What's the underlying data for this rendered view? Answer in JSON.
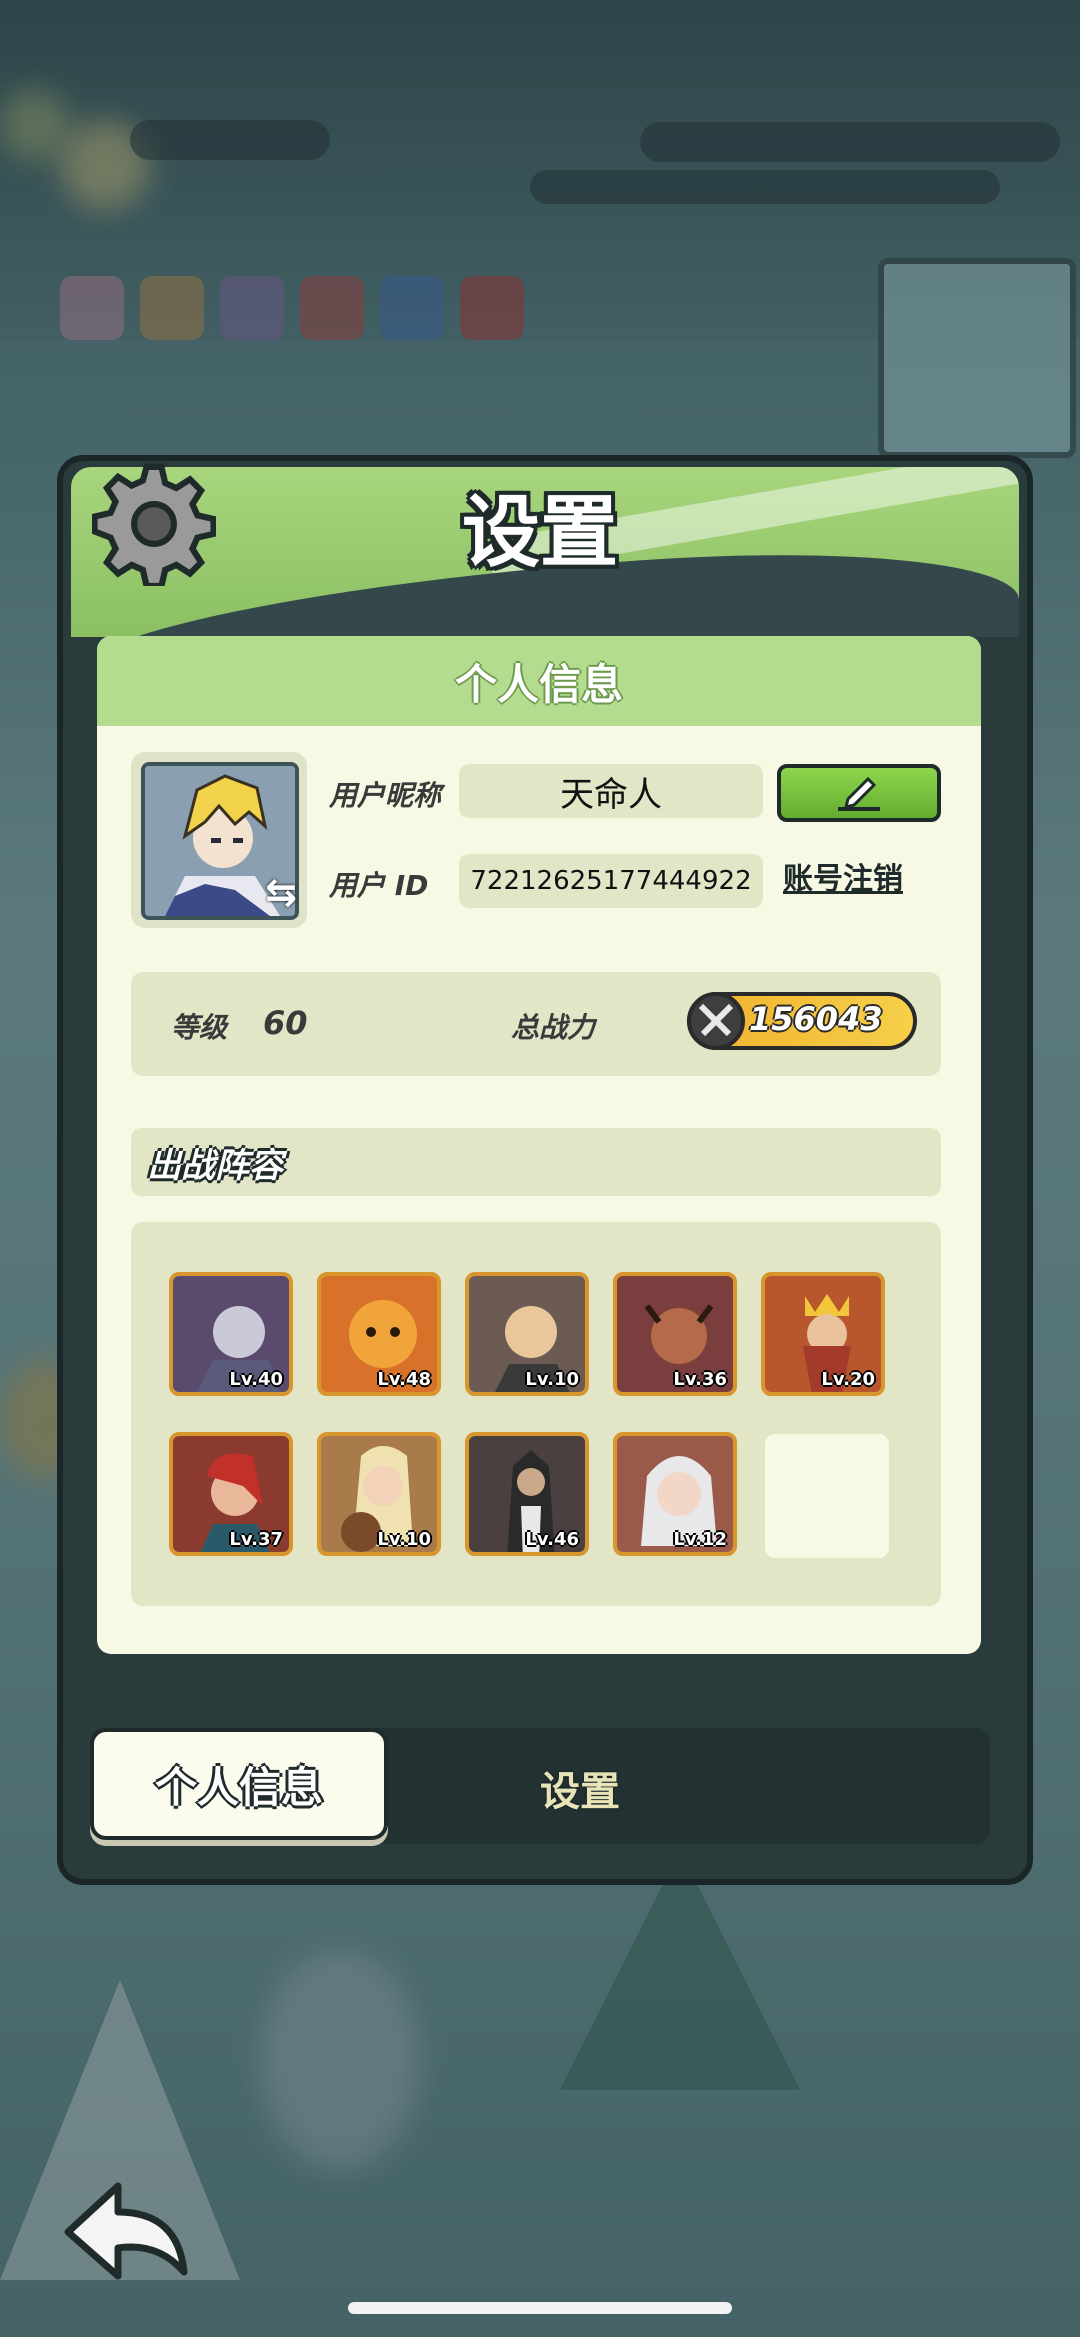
{
  "background": {
    "description_icons": [
      "coin-icon",
      "gem-icon"
    ]
  },
  "dialog": {
    "title": "设置",
    "section_header": "个人信息",
    "profile": {
      "nickname_label": "用户昵称",
      "nickname_value": "天命人",
      "id_label": "用户 ID",
      "id_value": "72212625177444922",
      "cancel_account_label": "账号注销"
    },
    "stats": {
      "level_label": "等级",
      "level_value": "60",
      "power_label": "总战力",
      "power_value": "156043"
    },
    "lineup": {
      "title": "出战阵容",
      "heroes": [
        {
          "level": "Lv.40",
          "color": "#5a4a6e"
        },
        {
          "level": "Lv.48",
          "color": "#d8722a"
        },
        {
          "level": "Lv.10",
          "color": "#6b5b52"
        },
        {
          "level": "Lv.36",
          "color": "#7a3e3e"
        },
        {
          "level": "Lv.20",
          "color": "#b8562e"
        },
        {
          "level": "Lv.37",
          "color": "#8a3a2e"
        },
        {
          "level": "Lv.10",
          "color": "#a97a4a"
        },
        {
          "level": "Lv.46",
          "color": "#4a4040"
        },
        {
          "level": "Lv.12",
          "color": "#9a5a4a"
        }
      ]
    },
    "tabs": [
      {
        "label": "个人信息",
        "active": true
      },
      {
        "label": "设置",
        "active": false
      }
    ]
  },
  "colors": {
    "panel_green": "#8bbf62",
    "card_bg": "#f7f9e4",
    "hero_border": "#d9962c",
    "edit_button": "#6fbf3a"
  }
}
